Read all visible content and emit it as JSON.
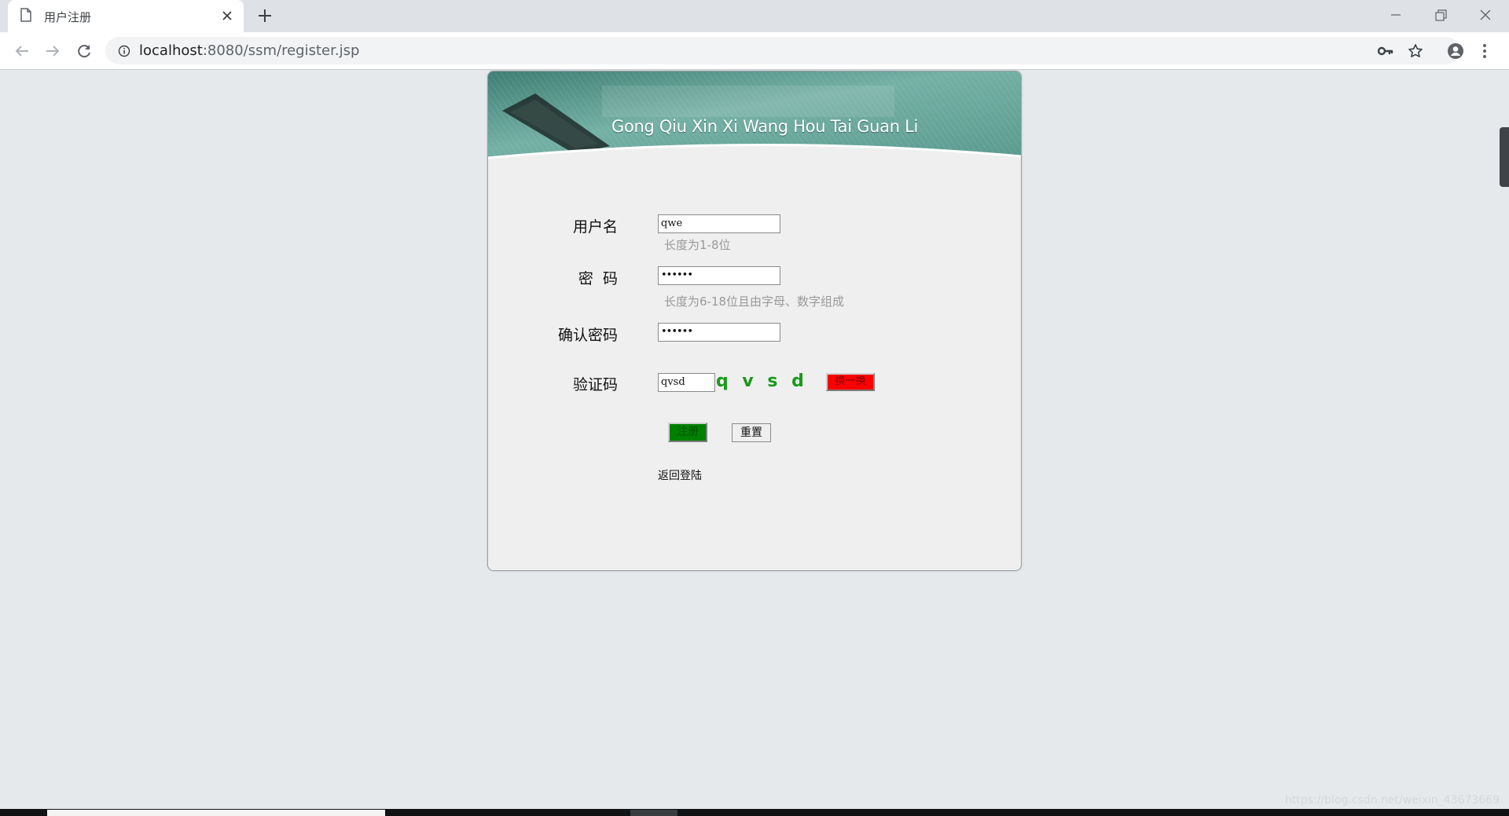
{
  "browser": {
    "tab_title": "用户注册",
    "url_host": "localhost",
    "url_rest": ":8080/ssm/register.jsp"
  },
  "banner": {
    "text": "Gong Qiu Xin Xi Wang Hou Tai Guan Li"
  },
  "form": {
    "username": {
      "label": "用户名",
      "value": "qwe",
      "hint": "长度为1-8位"
    },
    "password": {
      "label": "密  码",
      "value": "••••••",
      "hint": "长度为6-18位且由字母、数字组成"
    },
    "confirm": {
      "label": "确认密码",
      "value": "••••••"
    },
    "captcha": {
      "label": "验证码",
      "value": "qvsd",
      "code": "q v s d",
      "change_label": "换一换"
    },
    "register_label": "注册",
    "reset_label": "重置",
    "back_label": "返回登陆"
  },
  "colors": {
    "captcha_text": "#1a9a1a",
    "register_button": "#008000",
    "change_button": "#ff0000",
    "banner_teal": "#5f9e92"
  },
  "watermark": "https://blog.csdn.net/weixin_43673669"
}
